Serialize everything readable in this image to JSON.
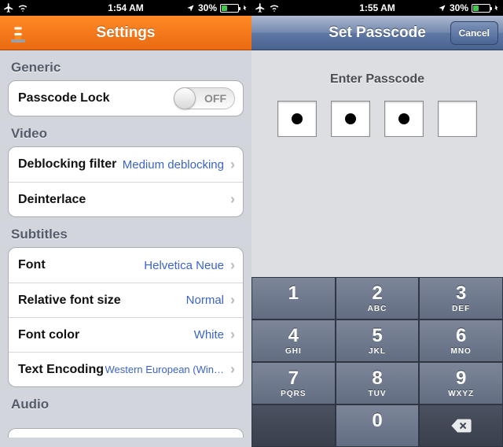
{
  "left": {
    "status": {
      "time": "1:54 AM",
      "battery_pct": "30%"
    },
    "header_title": "Settings",
    "sections": {
      "generic": {
        "label": "Generic",
        "passcode_lock": {
          "label": "Passcode Lock",
          "switch_off": "OFF"
        }
      },
      "video": {
        "label": "Video",
        "deblocking": {
          "label": "Deblocking filter",
          "value": "Medium deblocking"
        },
        "deinterlace": {
          "label": "Deinterlace"
        }
      },
      "subtitles": {
        "label": "Subtitles",
        "font": {
          "label": "Font",
          "value": "Helvetica Neue"
        },
        "relsize": {
          "label": "Relative font size",
          "value": "Normal"
        },
        "fontcolor": {
          "label": "Font color",
          "value": "White"
        },
        "encoding": {
          "label": "Text Encoding",
          "value": "Western European (Win…"
        }
      },
      "audio": {
        "label": "Audio"
      }
    }
  },
  "right": {
    "status": {
      "time": "1:55 AM",
      "battery_pct": "30%"
    },
    "header_title": "Set Passcode",
    "cancel_label": "Cancel",
    "prompt": "Enter Passcode",
    "entered_count": 3,
    "keypad": {
      "k1": {
        "num": "1",
        "sub": ""
      },
      "k2": {
        "num": "2",
        "sub": "ABC"
      },
      "k3": {
        "num": "3",
        "sub": "DEF"
      },
      "k4": {
        "num": "4",
        "sub": "GHI"
      },
      "k5": {
        "num": "5",
        "sub": "JKL"
      },
      "k6": {
        "num": "6",
        "sub": "MNO"
      },
      "k7": {
        "num": "7",
        "sub": "PQRS"
      },
      "k8": {
        "num": "8",
        "sub": "TUV"
      },
      "k9": {
        "num": "9",
        "sub": "WXYZ"
      },
      "k0": {
        "num": "0",
        "sub": ""
      }
    }
  }
}
